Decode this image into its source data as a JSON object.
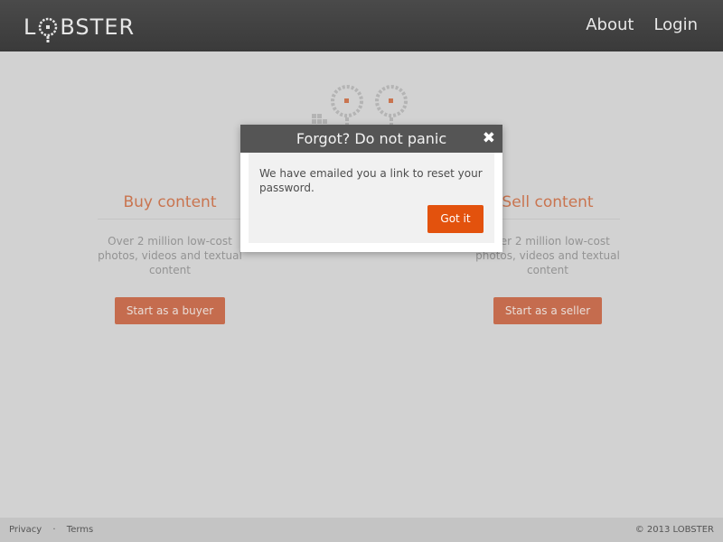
{
  "header": {
    "logo_prefix": "L",
    "logo_suffix": "BSTER",
    "nav": {
      "about": "About",
      "login": "Login"
    }
  },
  "main": {
    "buy": {
      "title": "Buy content",
      "description": "Over 2 million low-cost photos, videos and textual content",
      "button": "Start as a buyer"
    },
    "sell": {
      "title": "Sell content",
      "description": "Over 2 million low-cost photos, videos and textual content",
      "button": "Start as a seller"
    }
  },
  "modal": {
    "title": "Forgot? Do not panic",
    "close_glyph": "✖",
    "message": "We have emailed you a link to reset your password.",
    "button": "Got it"
  },
  "footer": {
    "privacy": "Privacy",
    "separator": "·",
    "terms": "Terms",
    "copyright": "© 2013 LOBSTER"
  },
  "colors": {
    "accent": "#c33b0d",
    "header": "#3f3f3f",
    "modal_button": "#e3520d"
  }
}
